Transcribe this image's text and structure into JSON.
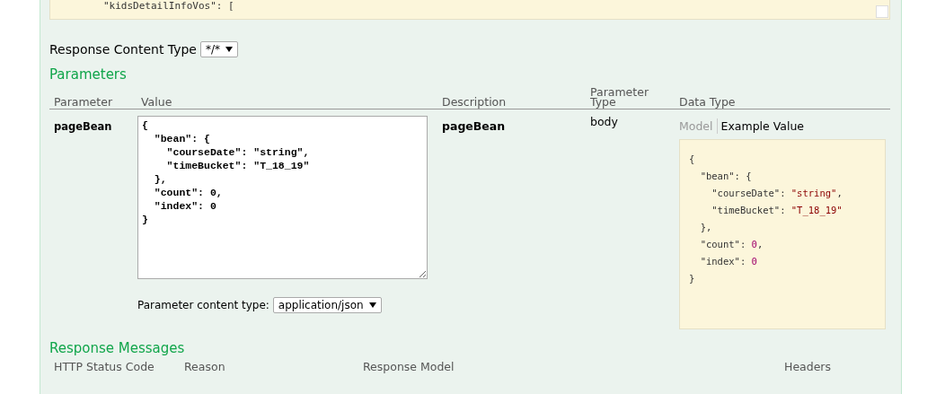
{
  "top_snippet": {
    "text": "        \"kidsDetailInfoVos\": ["
  },
  "response_content_type": {
    "label": "Response Content Type",
    "value": "*/*"
  },
  "parameters": {
    "title": "Parameters",
    "columns": [
      "Parameter",
      "Value",
      "Description",
      "Parameter\nType",
      "Data Type"
    ],
    "rows": [
      {
        "name": "pageBean",
        "value": "{\n  \"bean\": {\n    \"courseDate\": \"string\",\n    \"timeBucket\": \"T_18_19\"\n  },\n  \"count\": 0,\n  \"index\": 0\n}",
        "content_type_label": "Parameter content type:",
        "content_type": "application/json",
        "description": "pageBean",
        "parameter_type": "body",
        "data_tabs": [
          {
            "label": "Model",
            "selected": false
          },
          {
            "label": "Example Value",
            "selected": true
          }
        ],
        "example_lines": [
          [
            {
              "kind": "plain",
              "text": "{"
            }
          ],
          [
            {
              "kind": "plain",
              "text": "  \"bean\": {"
            }
          ],
          [
            {
              "kind": "plain",
              "text": "    \"courseDate\": "
            },
            {
              "kind": "string",
              "text": "\"string\""
            },
            {
              "kind": "plain",
              "text": ","
            }
          ],
          [
            {
              "kind": "plain",
              "text": "    \"timeBucket\": "
            },
            {
              "kind": "string",
              "text": "\"T_18_19\""
            }
          ],
          [
            {
              "kind": "plain",
              "text": "  },"
            }
          ],
          [
            {
              "kind": "plain",
              "text": "  \"count\": "
            },
            {
              "kind": "number",
              "text": "0"
            },
            {
              "kind": "plain",
              "text": ","
            }
          ],
          [
            {
              "kind": "plain",
              "text": "  \"index\": "
            },
            {
              "kind": "number",
              "text": "0"
            }
          ],
          [
            {
              "kind": "plain",
              "text": "}"
            }
          ]
        ]
      }
    ]
  },
  "response_messages": {
    "title": "Response Messages",
    "columns": [
      "HTTP Status Code",
      "Reason",
      "Response Model",
      "Headers"
    ]
  }
}
